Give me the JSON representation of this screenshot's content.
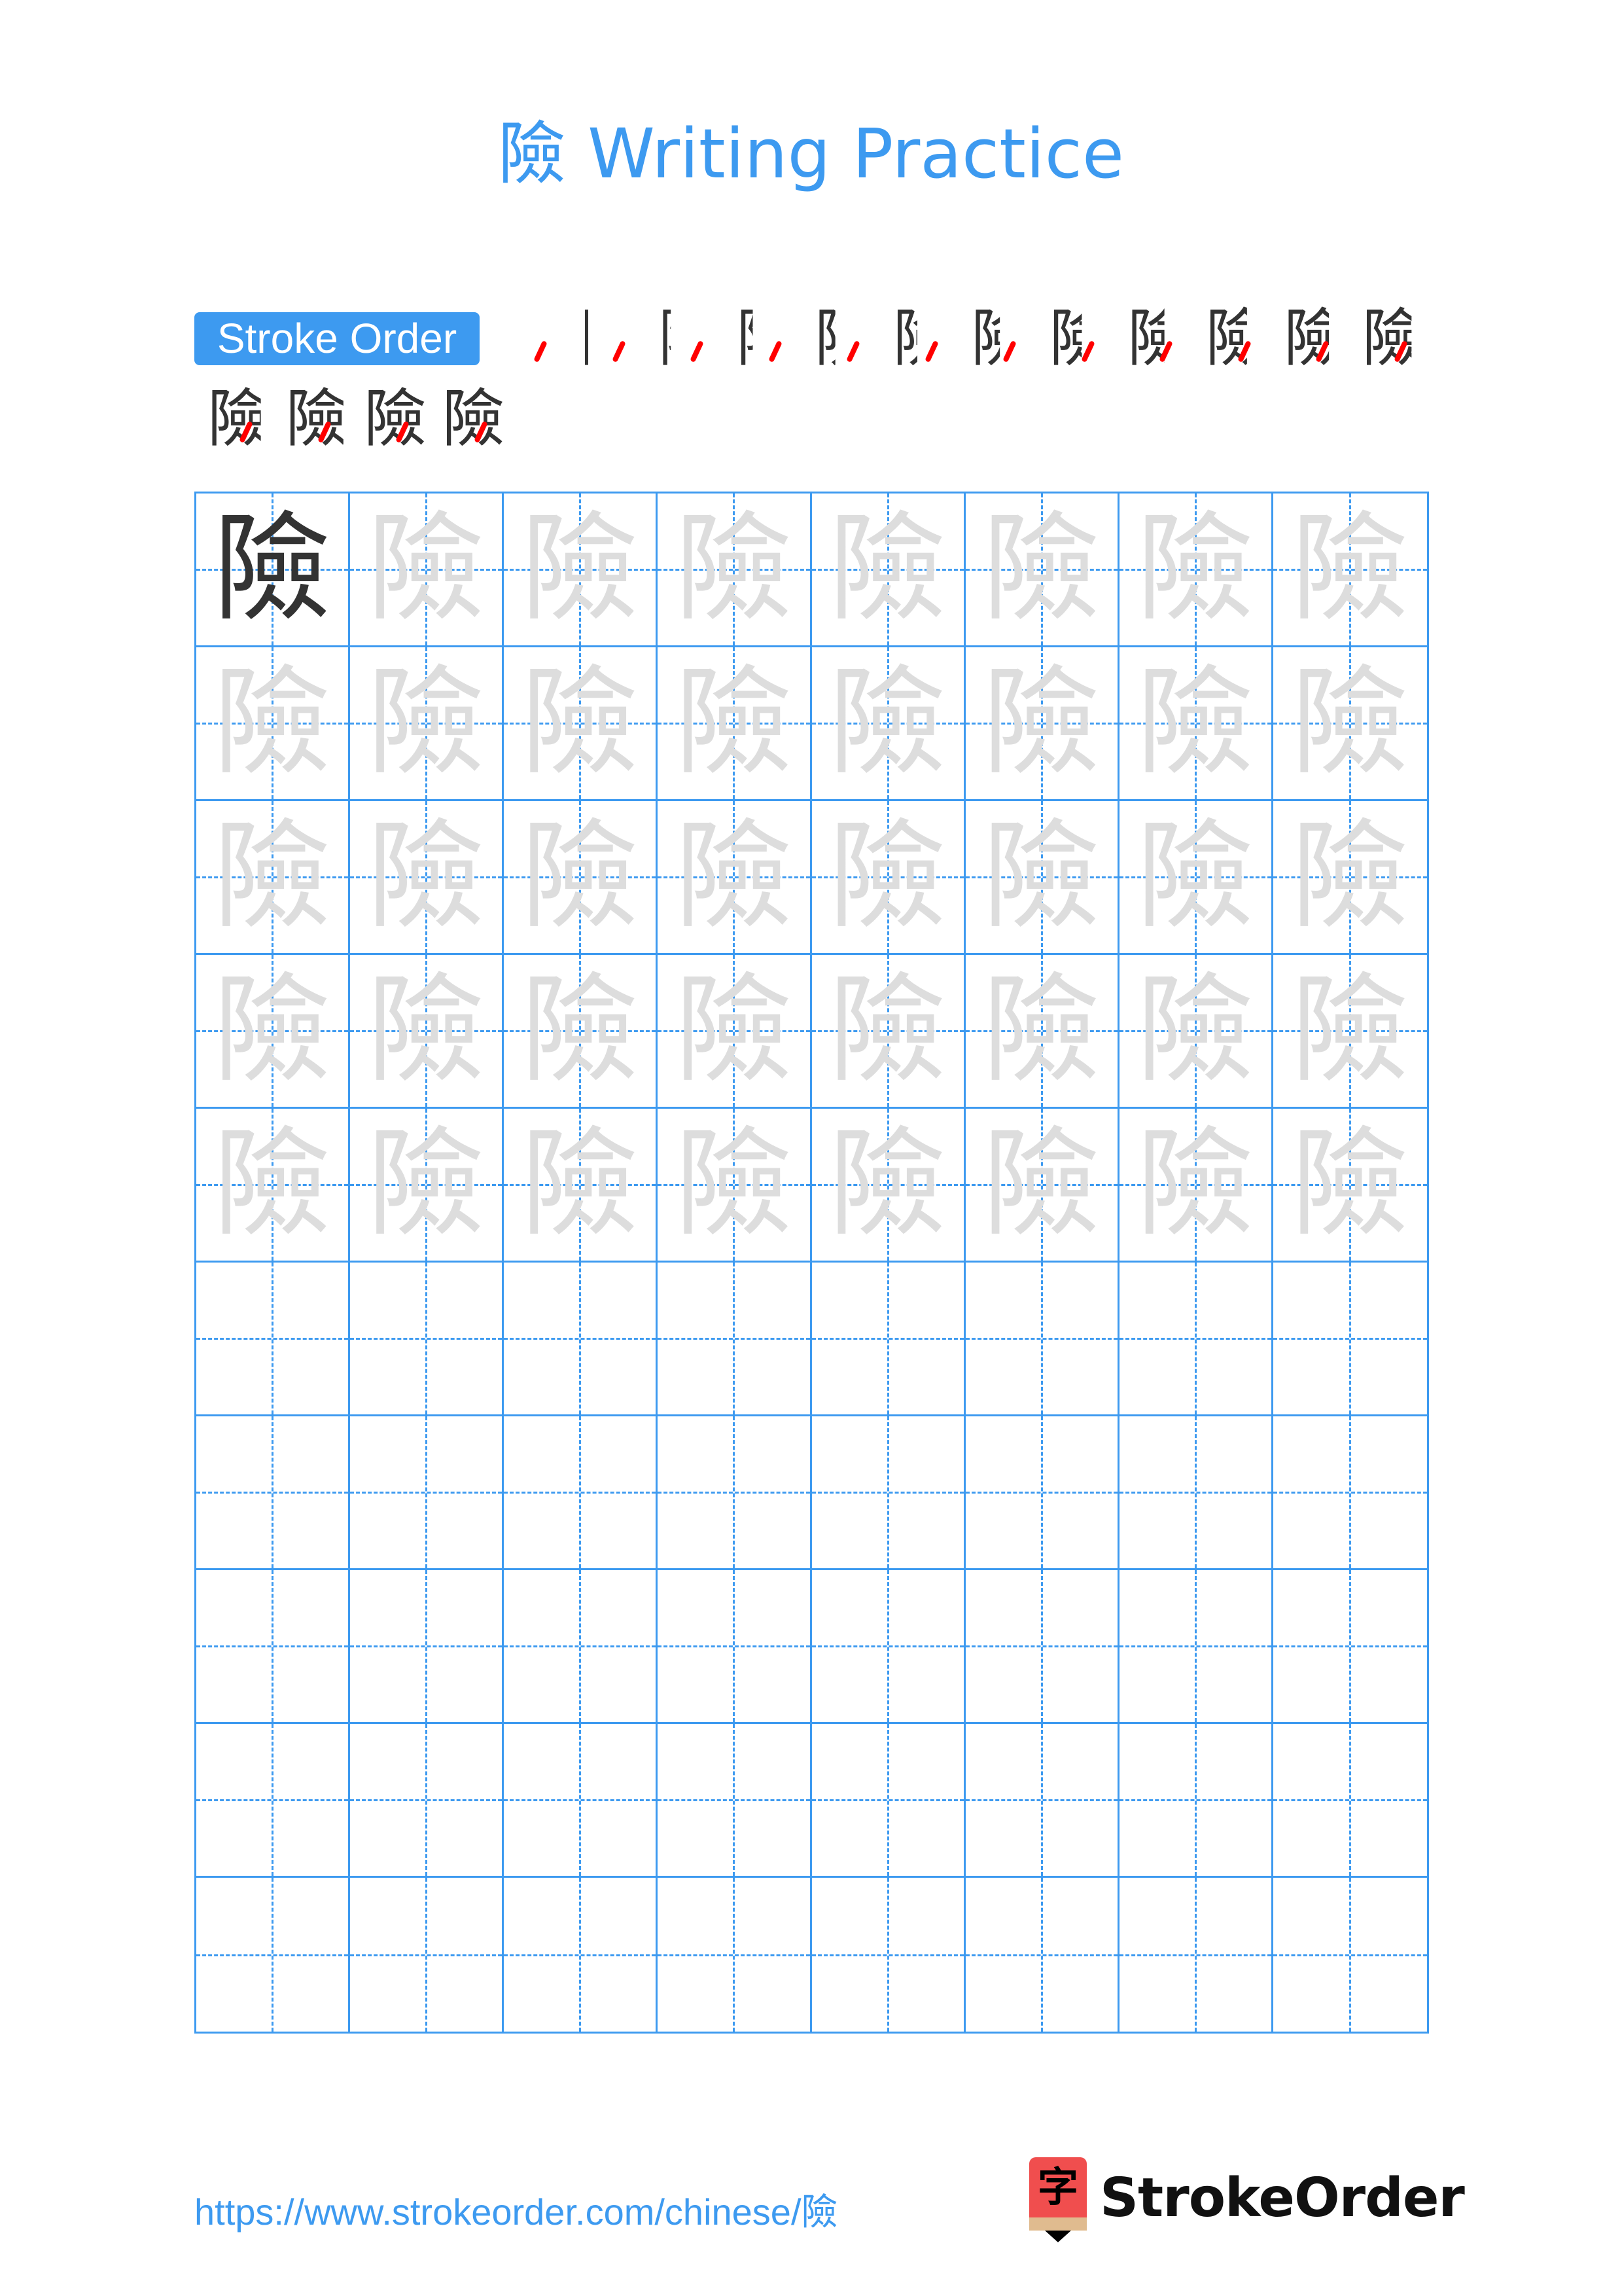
{
  "title": "險 Writing Practice",
  "stroke_order": {
    "label": "Stroke Order",
    "character": "險",
    "total_strokes": 16,
    "steps": [
      1,
      2,
      3,
      4,
      5,
      6,
      7,
      8,
      9,
      10,
      11,
      12,
      13,
      14,
      15,
      16
    ]
  },
  "practice_grid": {
    "character": "險",
    "columns": 8,
    "rows": 10,
    "model_cells": 1,
    "trace_cells": 39,
    "blank_rows": 5
  },
  "footer": {
    "url": "https://www.strokeorder.com/chinese/險",
    "brand": "StrokeOrder",
    "logo_glyph": "字"
  },
  "colors": {
    "accent": "#3d9af0",
    "model": "#333333",
    "trace": "#dddddd",
    "highlight": "#ff0000",
    "logo_red": "#f04e4e"
  }
}
